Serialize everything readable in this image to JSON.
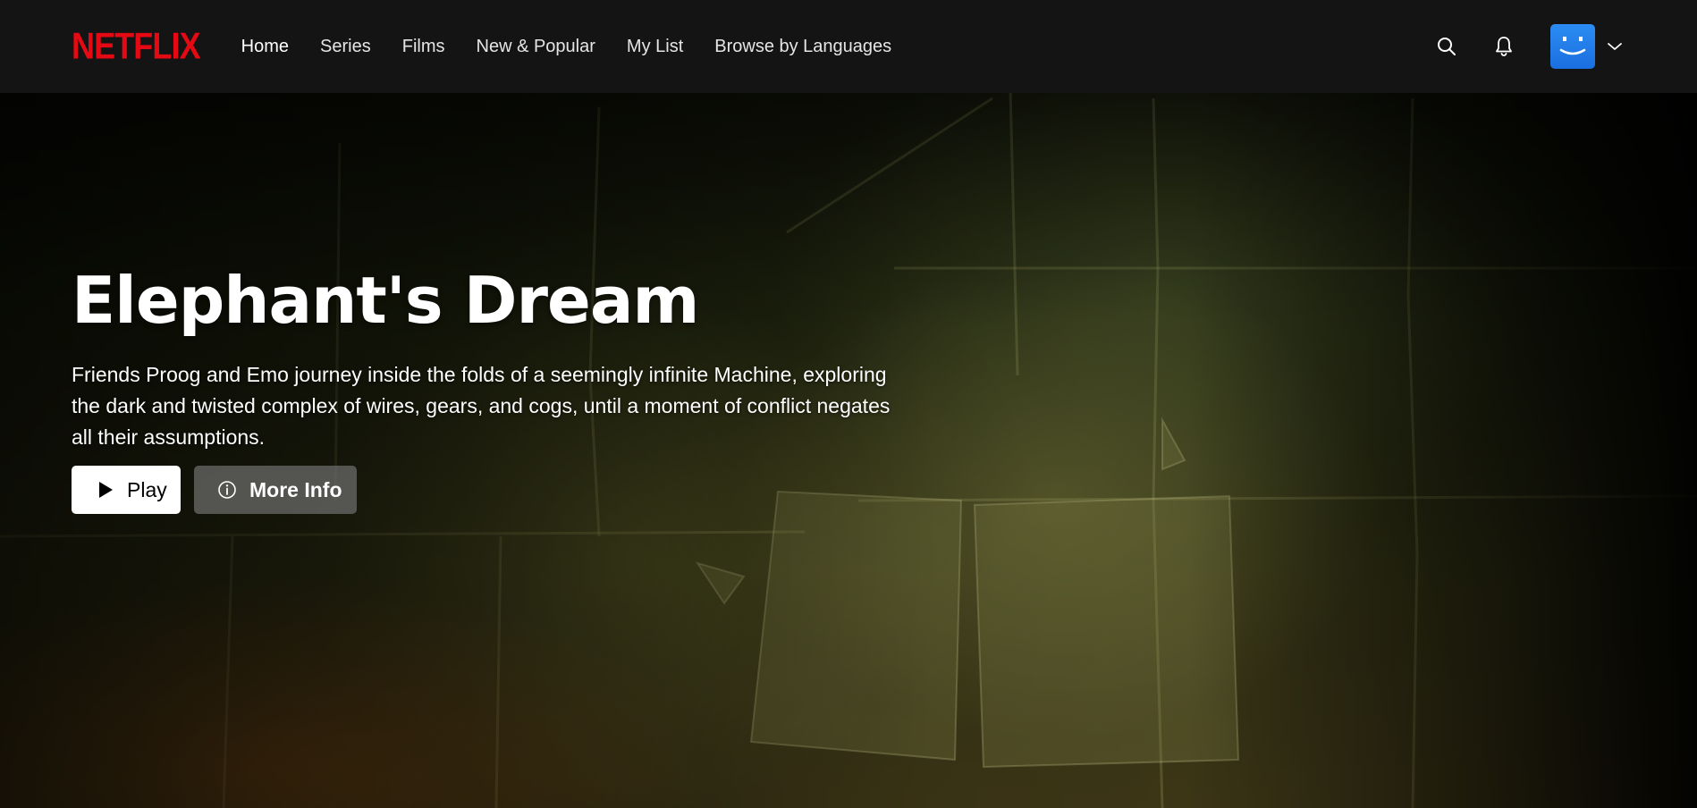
{
  "nav": {
    "logo": "NETFLIX",
    "links": [
      {
        "label": "Home",
        "active": true
      },
      {
        "label": "Series"
      },
      {
        "label": "Films"
      },
      {
        "label": "New & Popular"
      },
      {
        "label": "My List"
      },
      {
        "label": "Browse by Languages"
      }
    ],
    "icons": [
      "search-icon",
      "bell-icon",
      "avatar",
      "chevron-down-icon"
    ]
  },
  "hero": {
    "title": "Elephant's Dream",
    "description": "Friends Proog and Emo journey inside the folds of a seemingly infinite Machine, exploring the dark and twisted complex of wires, gears, and cogs, until a moment of conflict negates all their assumptions.",
    "play_label": "Play",
    "more_info_label": "More Info"
  },
  "colors": {
    "brand": "#e50914",
    "nav_bg": "#141414",
    "avatar": "#2c8cf3"
  }
}
